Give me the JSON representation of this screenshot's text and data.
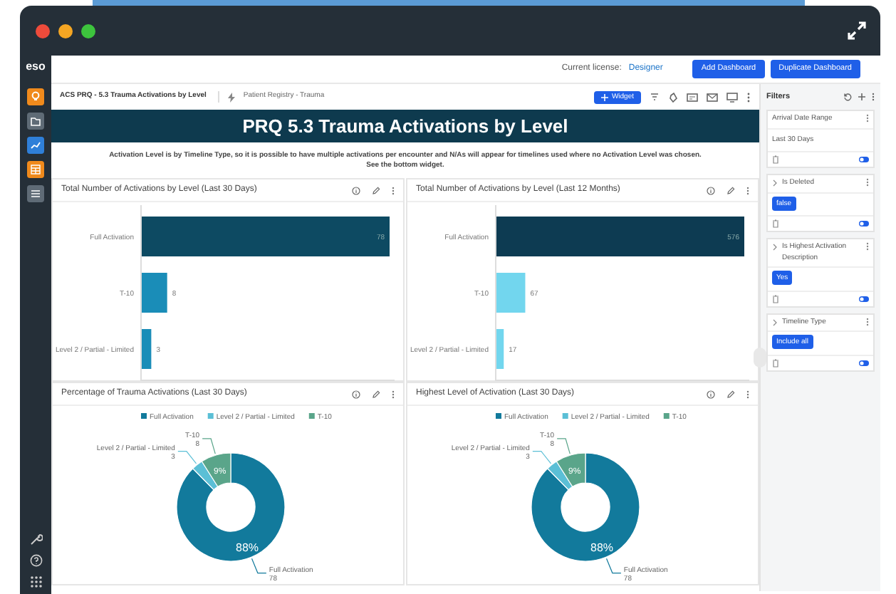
{
  "sidebar": {
    "logo": "eso"
  },
  "header": {
    "license_label": "Current license:",
    "license_value": "Designer",
    "buttons": [
      "Add Dashboard",
      "Duplicate Dashboard"
    ]
  },
  "toolbar": {
    "dashboard_title": "ACS PRQ - 5.3 Trauma Activations by Level",
    "datasource": "Patient Registry - Trauma",
    "widget_button": "Widget"
  },
  "banner": {
    "title": "PRQ 5.3 Trauma Activations by Level",
    "description": "Activation Level is by Timeline Type, so it is possible to have multiple activations per encounter and N/As will appear for timelines used where no Activation Level was chosen. See the bottom widget."
  },
  "widgets": [
    {
      "title": "Total Number of Activations by Level (Last 30 Days)",
      "chart_data": {
        "type": "bar",
        "orientation": "horizontal",
        "categories": [
          "Full Activation",
          "T-10",
          "Level 2 / Partial - Limited"
        ],
        "series": [
          {
            "values": [
              78,
              8,
              3
            ]
          }
        ],
        "colors": [
          "#0d4a62",
          "#1a8db8",
          "#1a8db8"
        ],
        "data_labels": true
      }
    },
    {
      "title": "Total Number of Activations by Level (Last 12 Months)",
      "chart_data": {
        "type": "bar",
        "orientation": "horizontal",
        "categories": [
          "Full Activation",
          "T-10",
          "Level 2 / Partial - Limited"
        ],
        "series": [
          {
            "values": [
              576,
              67,
              17
            ]
          }
        ],
        "colors": [
          "#0d3b52",
          "#72d6ee",
          "#72d6ee"
        ],
        "data_labels": true
      }
    },
    {
      "title": "Percentage of Trauma Activations (Last 30 Days)",
      "slice_percents": {
        "first_slice": "88%",
        "third_slice": "9%"
      },
      "chart_data": {
        "type": "donut",
        "categories": [
          "Full Activation",
          "Level 2 / Partial - Limited",
          "T-10"
        ],
        "values": [
          78,
          3,
          8
        ],
        "colors": [
          "#127a9c",
          "#5bbfd6",
          "#5aa58a"
        ],
        "legend": "top",
        "data_labels": true,
        "value_labels": [
          "78",
          "3",
          "8"
        ]
      }
    },
    {
      "title": "Highest Level of Activation (Last 30 Days)",
      "slice_percents": {
        "first_slice": "88%",
        "third_slice": "9%"
      },
      "chart_data": {
        "type": "donut",
        "categories": [
          "Full Activation",
          "Level 2 / Partial - Limited",
          "T-10"
        ],
        "values": [
          78,
          3,
          8
        ],
        "colors": [
          "#127a9c",
          "#5bbfd6",
          "#5aa58a"
        ],
        "legend": "top",
        "data_labels": true,
        "value_labels": [
          "78",
          "3",
          "8"
        ]
      }
    }
  ],
  "filters": {
    "title": "Filters",
    "items": [
      {
        "label": "Arrival Date Range",
        "kind": "text",
        "value": "Last 30 Days",
        "expandable": false
      },
      {
        "label": "Is Deleted",
        "kind": "chip",
        "value": "false",
        "expandable": true
      },
      {
        "label": "Is Highest Activation Description",
        "kind": "chip",
        "value": "Yes",
        "expandable": true
      },
      {
        "label": "Timeline Type",
        "kind": "chip",
        "value": "Include all",
        "expandable": true
      }
    ]
  }
}
